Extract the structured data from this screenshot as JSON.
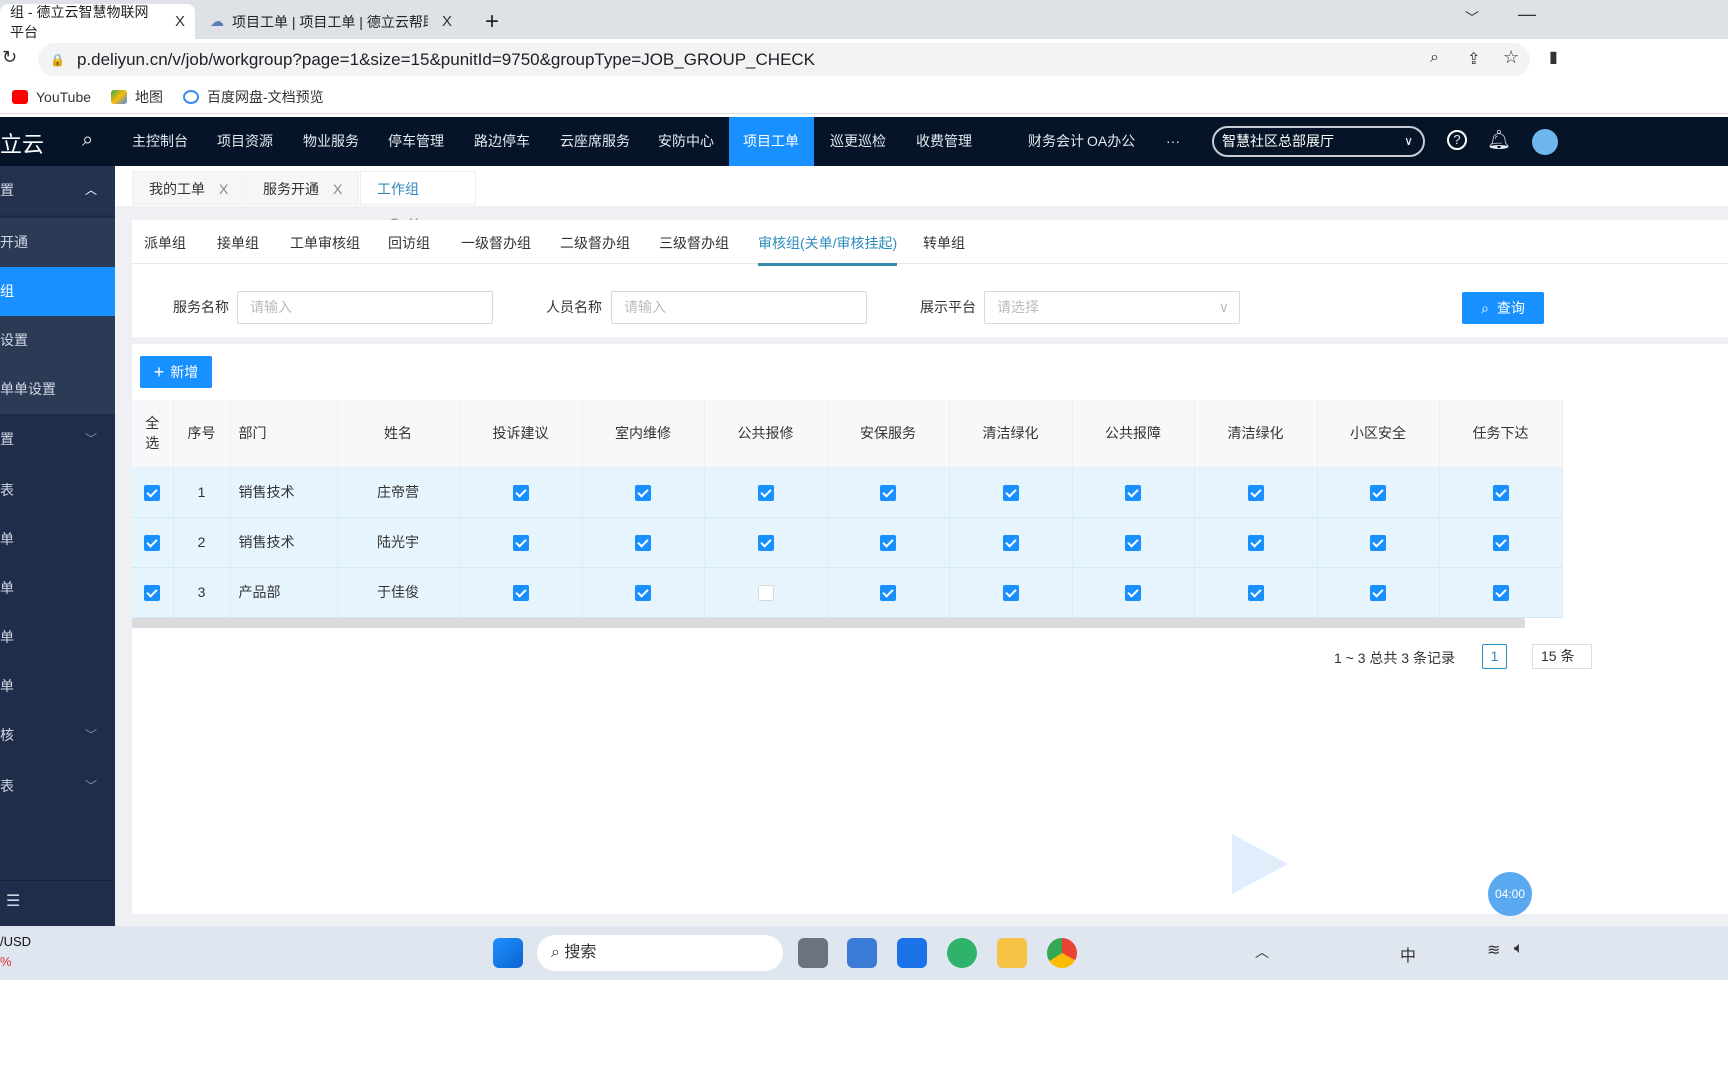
{
  "browser": {
    "tabs": [
      {
        "title": "组 - 德立云智慧物联网平台",
        "close": "X"
      },
      {
        "title": "项目工单 | 项目工单 | 德立云帮助",
        "close": "X"
      }
    ],
    "new_tab": "+",
    "url": "p.deliyun.cn/v/job/workgroup?page=1&size=15&punitId=9750&groupType=JOB_GROUP_CHECK",
    "bookmarks": [
      "YouTube",
      "地图",
      "百度网盘-文档预览"
    ]
  },
  "app": {
    "logo": "立云",
    "nav": [
      "主控制台",
      "项目资源",
      "物业服务",
      "停车管理",
      "路边停车",
      "云座席服务",
      "安防中心",
      "项目工单",
      "巡更巡检",
      "收费管理",
      "财务会计",
      "OA办公",
      "···"
    ],
    "active_nav": "项目工单",
    "project": "智慧社区总部展厅",
    "accent": "#1890ff"
  },
  "sidebar": {
    "items": [
      {
        "label": "置",
        "chevron": "up"
      },
      {
        "label": "开通"
      },
      {
        "label": "组"
      },
      {
        "label": "设置"
      },
      {
        "label": "单单设置"
      },
      {
        "label": "置",
        "chevron": "down"
      },
      {
        "label": "表"
      },
      {
        "label": "单"
      },
      {
        "label": "单"
      },
      {
        "label": "单"
      },
      {
        "label": "单"
      },
      {
        "label": "核",
        "chevron": "down"
      },
      {
        "label": "表",
        "chevron": "down"
      }
    ]
  },
  "page_tabs": [
    {
      "label": "我的工单",
      "close": "X"
    },
    {
      "label": "服务开通",
      "close": "X"
    },
    {
      "label": "工作组",
      "refresh": "C",
      "close": "X"
    }
  ],
  "group_tabs": [
    "派单组",
    "接单组",
    "工单审核组",
    "回访组",
    "一级督办组",
    "二级督办组",
    "三级督办组",
    "审核组(关单/审核挂起)",
    "转单组"
  ],
  "active_group_tab": "审核组(关单/审核挂起)",
  "filters": {
    "service_label": "服务名称",
    "service_placeholder": "请输入",
    "person_label": "人员名称",
    "person_placeholder": "请输入",
    "platform_label": "展示平台",
    "platform_placeholder": "请选择",
    "query": "查询"
  },
  "add_button": "新增",
  "table": {
    "headers": [
      "全选",
      "序号",
      "部门",
      "姓名",
      "投诉建议",
      "室内维修",
      "公共报修",
      "安保服务",
      "清洁绿化",
      "公共报障",
      "清洁绿化",
      "小区安全",
      "任务下达"
    ],
    "rows": [
      {
        "index": "1",
        "dept": "销售技术",
        "name": "庄帝营",
        "selected": true,
        "checks": [
          true,
          true,
          true,
          true,
          true,
          true,
          true,
          true,
          true
        ]
      },
      {
        "index": "2",
        "dept": "销售技术",
        "name": "陆光宇",
        "selected": true,
        "checks": [
          true,
          true,
          true,
          true,
          true,
          true,
          true,
          true,
          true
        ]
      },
      {
        "index": "3",
        "dept": "产品部",
        "name": "于佳俊",
        "selected": true,
        "checks": [
          true,
          true,
          false,
          true,
          true,
          true,
          true,
          true,
          true
        ]
      }
    ]
  },
  "pagination": {
    "summary": "1 ~ 3 总共 3 条记录",
    "page": "1",
    "size": "15 条"
  },
  "timer": "04:00",
  "taskbar": {
    "search": "搜索",
    "ticker": "/USD",
    "ticker_change": "%",
    "ime": "中"
  }
}
